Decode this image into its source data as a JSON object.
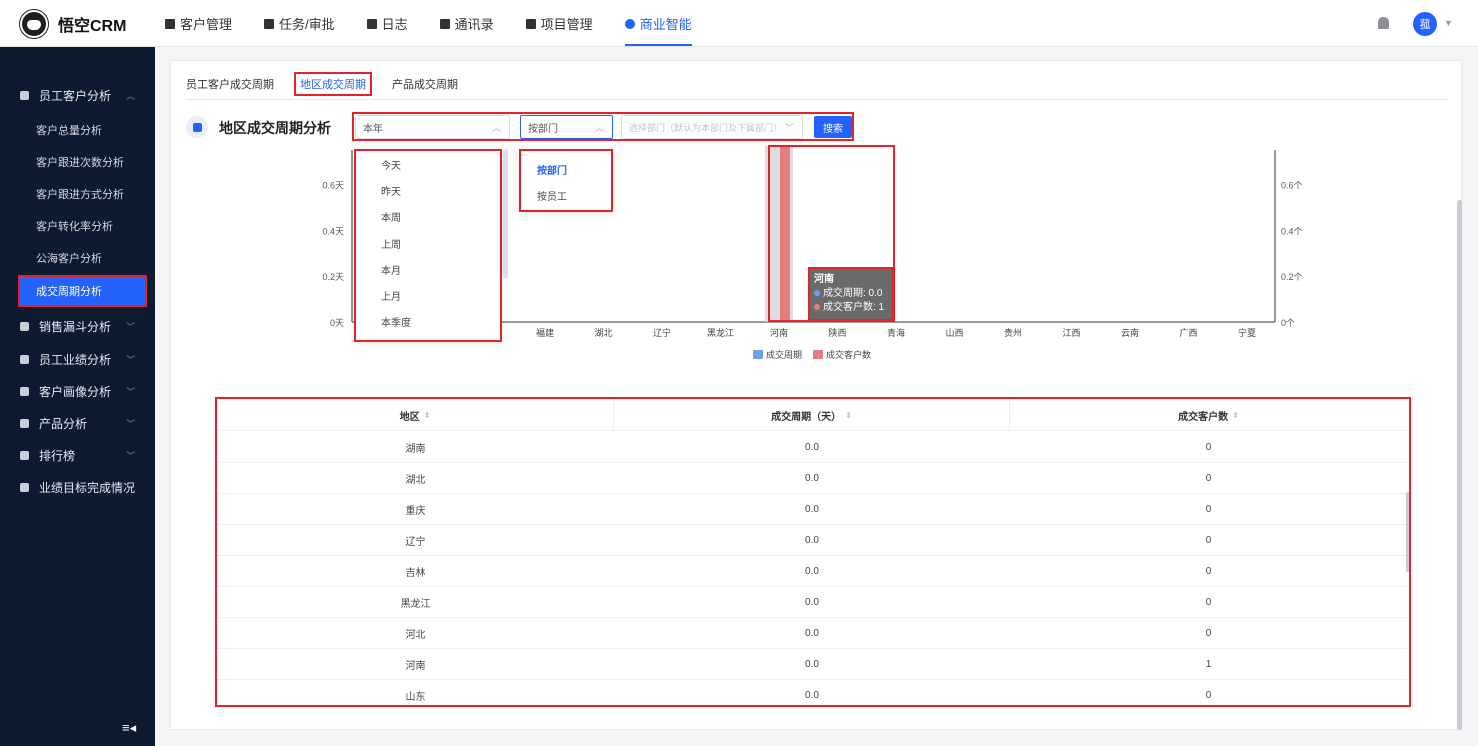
{
  "app": {
    "name": "悟空CRM",
    "avatar_text": "菰"
  },
  "nav": [
    {
      "label": "客户管理"
    },
    {
      "label": "任务/审批"
    },
    {
      "label": "日志"
    },
    {
      "label": "通讯录"
    },
    {
      "label": "项目管理"
    },
    {
      "label": "商业智能",
      "active": true
    }
  ],
  "sidebar": {
    "groups": [
      {
        "label": "员工客户分析",
        "expanded": true
      },
      {
        "label": "销售漏斗分析"
      },
      {
        "label": "员工业绩分析"
      },
      {
        "label": "客户画像分析"
      },
      {
        "label": "产品分析"
      },
      {
        "label": "排行榜"
      },
      {
        "label": "业绩目标完成情况"
      }
    ],
    "subitems": [
      {
        "label": "客户总量分析"
      },
      {
        "label": "客户跟进次数分析"
      },
      {
        "label": "客户跟进方式分析"
      },
      {
        "label": "客户转化率分析"
      },
      {
        "label": "公海客户分析"
      },
      {
        "label": "成交周期分析",
        "active": true
      }
    ]
  },
  "tabs": [
    {
      "label": "员工客户成交周期"
    },
    {
      "label": "地区成交周期",
      "active": true
    },
    {
      "label": "产品成交周期"
    }
  ],
  "page_title": "地区成交周期分析",
  "filters": {
    "period_value": "本年",
    "mode_value": "按部门",
    "dept_placeholder": "选择部门（默认为本部门及下属部门）",
    "search_label": "搜索"
  },
  "period_options": [
    "今天",
    "昨天",
    "本周",
    "上周",
    "本月",
    "上月",
    "本季度"
  ],
  "mode_options": [
    {
      "label": "按部门",
      "active": true
    },
    {
      "label": "按员工"
    }
  ],
  "chart_data": {
    "type": "bar",
    "categories": [
      "湖南",
      "湖北",
      "重庆",
      "辽宁",
      "吉林",
      "黑龙江",
      "河北",
      "河南",
      "山东",
      "福建",
      "湖北",
      "辽宁",
      "黑龙江",
      "河南",
      "陕西",
      "青海",
      "山西",
      "贵州",
      "江西",
      "云南",
      "广西",
      "宁夏"
    ],
    "visible_categories": [
      "福建",
      "湖北",
      "辽宁",
      "黑龙江",
      "河南",
      "陕西",
      "青海",
      "山西",
      "贵州",
      "江西",
      "云南",
      "广西",
      "宁夏"
    ],
    "series": [
      {
        "name": "成交周期",
        "color": "#6d9eeb",
        "values": [
          0,
          0,
          0,
          0,
          0,
          0,
          0,
          0,
          0,
          0,
          0,
          0,
          0
        ]
      },
      {
        "name": "成交客户数",
        "color": "#e37f80",
        "values": [
          0,
          0,
          0,
          0,
          1,
          0,
          0,
          0,
          0,
          0,
          0,
          0,
          0
        ]
      }
    ],
    "y_left_ticks": [
      "0天",
      "0.2天",
      "0.4天",
      "0.6天"
    ],
    "y_right_ticks": [
      "0个",
      "0.2个",
      "0.4个",
      "0.6个"
    ],
    "highlight_category": "河南",
    "tooltip": {
      "title": "河南",
      "line1": "成交周期: 0.0",
      "line2": "成交客户数: 1"
    },
    "legend": [
      "成交周期",
      "成交客户数"
    ]
  },
  "table": {
    "headers": [
      "地区",
      "成交周期（天）",
      "成交客户数"
    ],
    "rows": [
      [
        "湖南",
        "0.0",
        "0"
      ],
      [
        "湖北",
        "0.0",
        "0"
      ],
      [
        "重庆",
        "0.0",
        "0"
      ],
      [
        "辽宁",
        "0.0",
        "0"
      ],
      [
        "吉林",
        "0.0",
        "0"
      ],
      [
        "黑龙江",
        "0.0",
        "0"
      ],
      [
        "河北",
        "0.0",
        "0"
      ],
      [
        "河南",
        "0.0",
        "1"
      ],
      [
        "山东",
        "0.0",
        "0"
      ]
    ]
  }
}
